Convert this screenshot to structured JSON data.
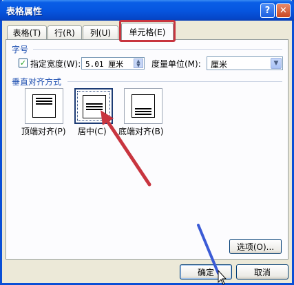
{
  "window": {
    "title": "表格属性",
    "help_glyph": "?",
    "close_glyph": "✕"
  },
  "tabs": [
    {
      "label": "表格(T)"
    },
    {
      "label": "行(R)"
    },
    {
      "label": "列(U)"
    },
    {
      "label": "单元格(E)",
      "active": true
    }
  ],
  "size_group": {
    "title": "字号",
    "checkbox_label": "指定宽度(W):",
    "checked": true,
    "width_value": "5.01 厘米",
    "unit_label": "度量单位(M):",
    "unit_value": "厘米"
  },
  "vertical_align_group": {
    "title": "垂直对齐方式",
    "options": [
      {
        "label": "顶端对齐(P)"
      },
      {
        "label": "居中(C)",
        "selected": true
      },
      {
        "label": "底端对齐(B)"
      }
    ]
  },
  "buttons": {
    "options_label": "选项(O)...",
    "ok_label": "确定",
    "cancel_label": "取消"
  },
  "annotations": {
    "red_arrow_color": "#c8353f",
    "blue_line_color": "#3b5bd6"
  }
}
